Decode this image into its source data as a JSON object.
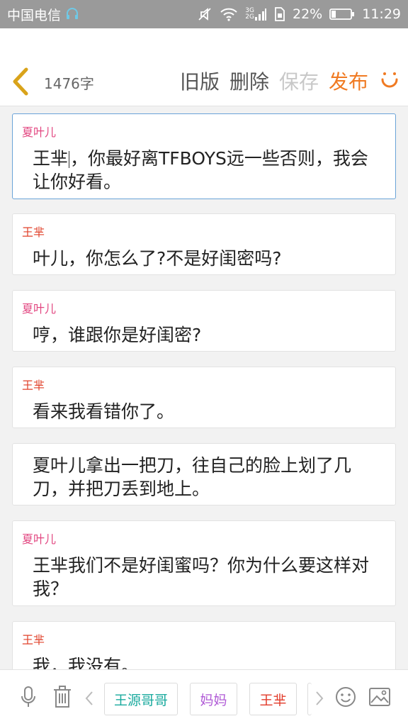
{
  "status": {
    "carrier": "中国电信",
    "battery": "22%",
    "time": "11:29",
    "net_top": "3G",
    "net_bottom": "2G"
  },
  "toolbar": {
    "word_count": "1476字",
    "old_version": "旧版",
    "delete": "删除",
    "save": "保存",
    "publish": "发布"
  },
  "entries": [
    {
      "speaker": "夏叶儿",
      "text_before_caret": "王芈",
      "text_after_caret": "，你最好离TFBOYS远一些否则，我会让你好看。"
    },
    {
      "speaker": "王芈",
      "text": "叶儿，你怎么了?不是好闺密吗?"
    },
    {
      "speaker": "夏叶儿",
      "text": "哼，谁跟你是好闺密?"
    },
    {
      "speaker": "王芈",
      "text": "看来我看错你了。"
    },
    {
      "text": "夏叶儿拿出一把刀，往自己的脸上划了几刀，并把刀丢到地上。"
    },
    {
      "speaker": "夏叶儿",
      "text": "王芈我们不是好闺蜜吗？你为什么要这样对我？"
    },
    {
      "speaker": "王芈",
      "text": "我，我没有。"
    }
  ],
  "bottom": {
    "chips": [
      "王源哥哥",
      "妈妈",
      "王芈"
    ]
  },
  "colors": {
    "accent": "#f07a22",
    "speaker_xia": "#e24680",
    "speaker_wang": "#e0412a",
    "active_border": "#6aa3d8"
  }
}
